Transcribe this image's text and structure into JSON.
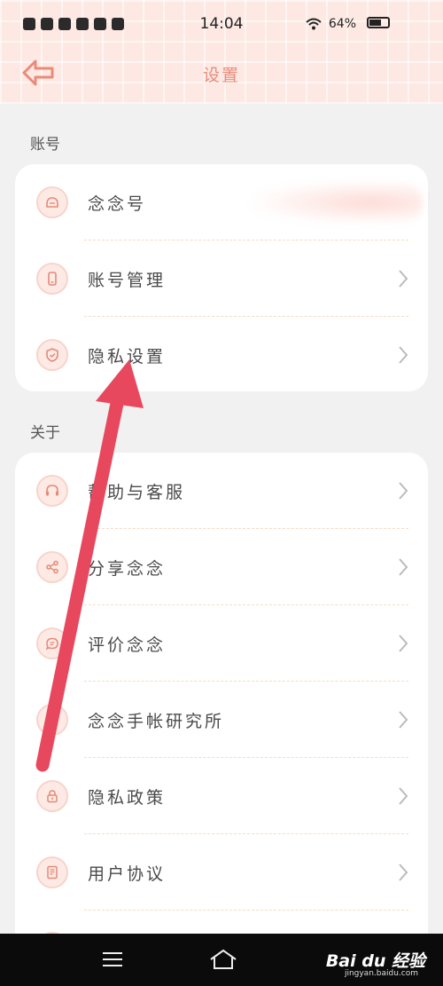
{
  "status_bar": {
    "time": "14:04",
    "battery": "64%",
    "battery_level": 0.64
  },
  "header": {
    "title": "设置",
    "back_icon": "back-arrow-icon"
  },
  "sections": [
    {
      "label": "账号",
      "items": [
        {
          "label": "念念号",
          "icon": "avatar-face-icon",
          "chevron": false
        },
        {
          "label": "账号管理",
          "icon": "phone-icon",
          "chevron": true
        },
        {
          "label": "隐私设置",
          "icon": "shield-check-icon",
          "chevron": true
        }
      ]
    },
    {
      "label": "关于",
      "items": [
        {
          "label": "帮助与客服",
          "icon": "headset-icon",
          "chevron": true
        },
        {
          "label": "分享念念",
          "icon": "share-icon",
          "chevron": true
        },
        {
          "label": "评价念念",
          "icon": "chat-bubble-icon",
          "chevron": true
        },
        {
          "label": "念念手帐研究所",
          "icon": "lab-icon",
          "chevron": true
        },
        {
          "label": "隐私政策",
          "icon": "lock-icon",
          "chevron": true
        },
        {
          "label": "用户协议",
          "icon": "document-icon",
          "chevron": true
        }
      ]
    }
  ],
  "watermark": {
    "text": "Bai du 经验",
    "sub": "jingyan.baidu.com"
  },
  "colors": {
    "accent": "#e98b7a",
    "header_bg": "#fde8e3",
    "arrow": "#e8485e",
    "icon_stroke": "#e48a7a"
  }
}
